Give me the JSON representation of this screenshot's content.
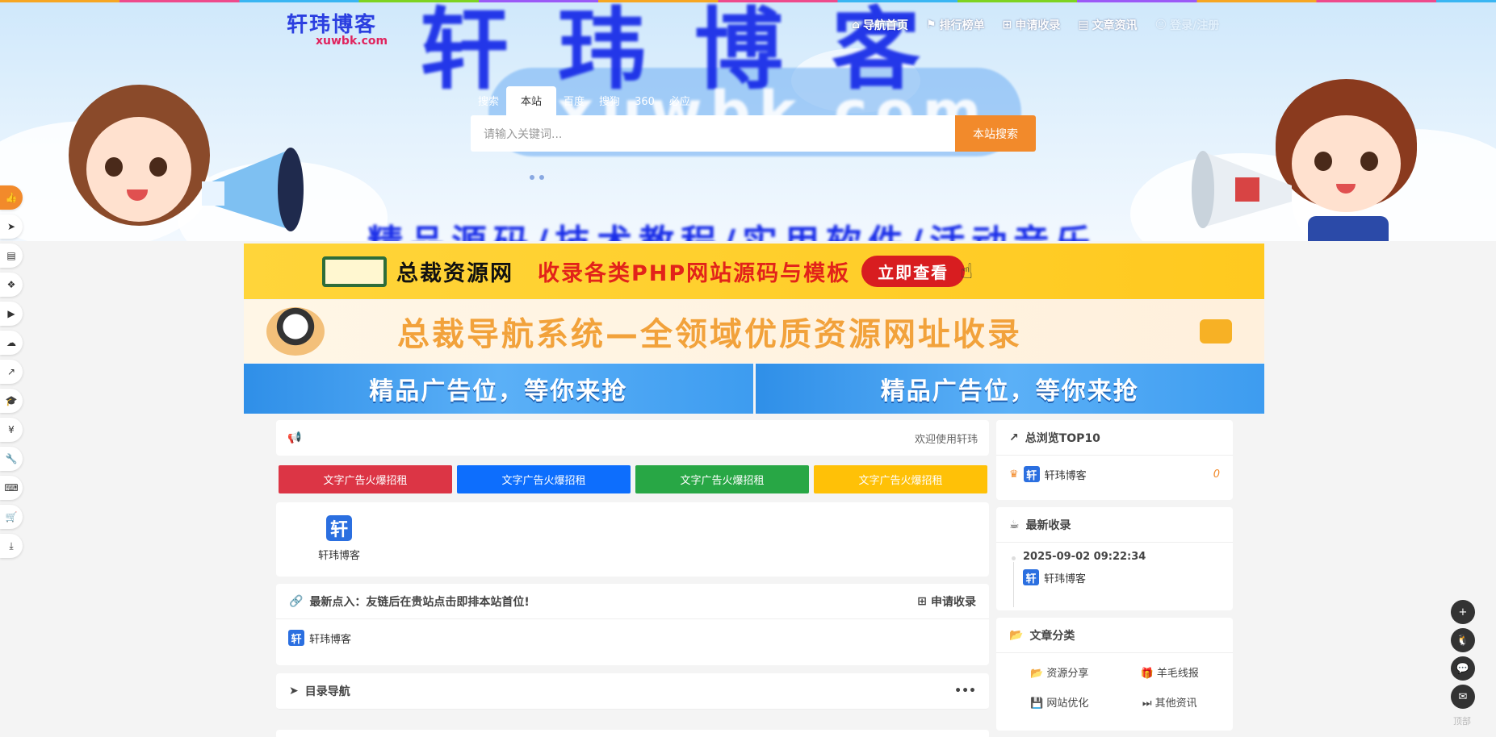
{
  "site": {
    "logo_text": "轩玮博客",
    "logo_sub": "xuwbk.com",
    "hero_big_text": "轩玮博客",
    "hero_url_text": "xuwbk.com",
    "hero_slogan": "精品源码/技术教程/实用软件/活动音乐"
  },
  "topnav": [
    {
      "icon": "home-icon",
      "label": "导航首页"
    },
    {
      "icon": "flag-icon",
      "label": "排行榜单"
    },
    {
      "icon": "plus-square-icon",
      "label": "申请收录"
    },
    {
      "icon": "book-icon",
      "label": "文章资讯"
    },
    {
      "icon": "user-icon",
      "label": "登录/注册"
    }
  ],
  "search": {
    "tabs": [
      "搜索",
      "本站",
      "百度",
      "搜狗",
      "360",
      "必应"
    ],
    "active_tab": "本站",
    "placeholder": "请输入关键词...",
    "button": "本站搜索"
  },
  "leftbar_icons": [
    "thumbs-up-icon",
    "paper-plane-icon",
    "file-icon",
    "cubes-icon",
    "youtube-icon",
    "cloud-icon",
    "chart-line-icon",
    "graduation-cap-icon",
    "yen-icon",
    "wrench-icon",
    "keyboard-icon",
    "cart-icon",
    "download-icon"
  ],
  "banners": {
    "b1_title": "总裁资源网",
    "b1_text": "收录各类PHP网站源码与模板",
    "b1_cta": "立即查看",
    "b2_text": "总裁导航系统—全领域优质资源网址收录",
    "b3_left": "精品广告位，等你来抢",
    "b3_right": "精品广告位，等你来抢"
  },
  "notice": {
    "icon": "bullhorn-icon",
    "text": "欢迎使用轩玮"
  },
  "text_ads": [
    {
      "label": "文字广告火爆招租",
      "color": "#dc3545"
    },
    {
      "label": "文字广告火爆招租",
      "color": "#0d6efd"
    },
    {
      "label": "文字广告火爆招租",
      "color": "#28a745"
    },
    {
      "label": "文字广告火爆招租",
      "color": "#ffc107"
    }
  ],
  "featured_site": {
    "icon_char": "轩",
    "name": "轩玮博客"
  },
  "latest_links": {
    "title": "最新点入：友链后在贵站点击即排本站首位!",
    "apply": "申请收录",
    "item": "轩玮博客",
    "icon_char": "轩"
  },
  "dir_nav": {
    "title": "目录导航",
    "more": "•••"
  },
  "top10": {
    "title": "总浏览TOP10",
    "item": "轩玮博客",
    "count": "0",
    "icon_char": "轩"
  },
  "recent": {
    "title": "最新收录",
    "date": "2025-09-02 09:22:34",
    "item": "轩玮博客",
    "icon_char": "轩"
  },
  "categories": {
    "title": "文章分类",
    "items": [
      {
        "icon": "folder-open-icon",
        "label": "资源分享"
      },
      {
        "icon": "gift-icon",
        "label": "羊毛线报"
      },
      {
        "icon": "save-icon",
        "label": "网站优化"
      },
      {
        "icon": "fast-forward-icon",
        "label": "其他资讯"
      }
    ]
  },
  "rightbar": {
    "icons": [
      "plus-square-icon",
      "qq-icon",
      "wechat-icon",
      "mail-icon"
    ],
    "totop": "顶部"
  },
  "colors": {
    "accent": "#f28a2b",
    "brand_blue": "#2b3fe0"
  }
}
